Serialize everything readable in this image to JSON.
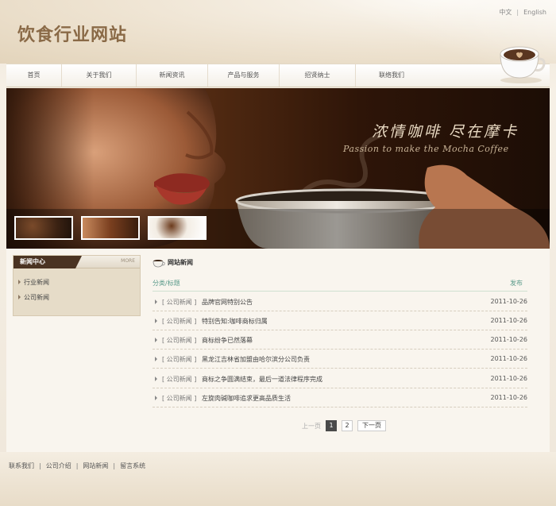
{
  "header": {
    "site_title": "饮食行业网站",
    "lang_cn": "中文",
    "lang_sep": "|",
    "lang_en": "English"
  },
  "nav": {
    "items": [
      {
        "label": "首页"
      },
      {
        "label": "关于我们"
      },
      {
        "label": "新闻资讯"
      },
      {
        "label": "产品与服务"
      },
      {
        "label": "招贤纳士"
      },
      {
        "label": "联络我们"
      }
    ]
  },
  "banner": {
    "slogan": "浓情咖啡 尽在摩卡",
    "subtitle": "Passion to make the Mocha Coffee"
  },
  "sidebar": {
    "title": "新闻中心",
    "more": "MORE",
    "links": [
      {
        "label": "行业新闻"
      },
      {
        "label": "公司新闻"
      }
    ]
  },
  "main": {
    "title": "网站新闻",
    "col_category": "分类/标题",
    "col_date": "发布",
    "news": [
      {
        "category": "[ 公司新闻 ]",
        "title": "品牌官网特别公告",
        "date": "2011-10-26"
      },
      {
        "category": "[ 公司新闻 ]",
        "title": "特别告知:咖啡商标归属",
        "date": "2011-10-26"
      },
      {
        "category": "[ 公司新闻 ]",
        "title": "商标纷争已然落幕",
        "date": "2011-10-26"
      },
      {
        "category": "[ 公司新闻 ]",
        "title": "黑龙江吉林省加盟由哈尔滨分公司负责",
        "date": "2011-10-26"
      },
      {
        "category": "[ 公司新闻 ]",
        "title": "商标之争圆满结束，最后一道法律程序完成",
        "date": "2011-10-26"
      },
      {
        "category": "[ 公司新闻 ]",
        "title": "左旋肉碱咖啡追求更高品质生活",
        "date": "2011-10-26"
      }
    ],
    "pager": {
      "prev": "上一页",
      "pages": [
        "1",
        "2"
      ],
      "next": "下一页"
    }
  },
  "footer": {
    "links": [
      {
        "label": "联系我们"
      },
      {
        "label": "公司介绍"
      },
      {
        "label": "网站新闻"
      },
      {
        "label": "留言系统"
      }
    ],
    "sep": "|"
  },
  "colors": {
    "brand_brown": "#8a6a47",
    "dark_brown": "#4a3322",
    "accent_teal": "#5a9a8a"
  }
}
